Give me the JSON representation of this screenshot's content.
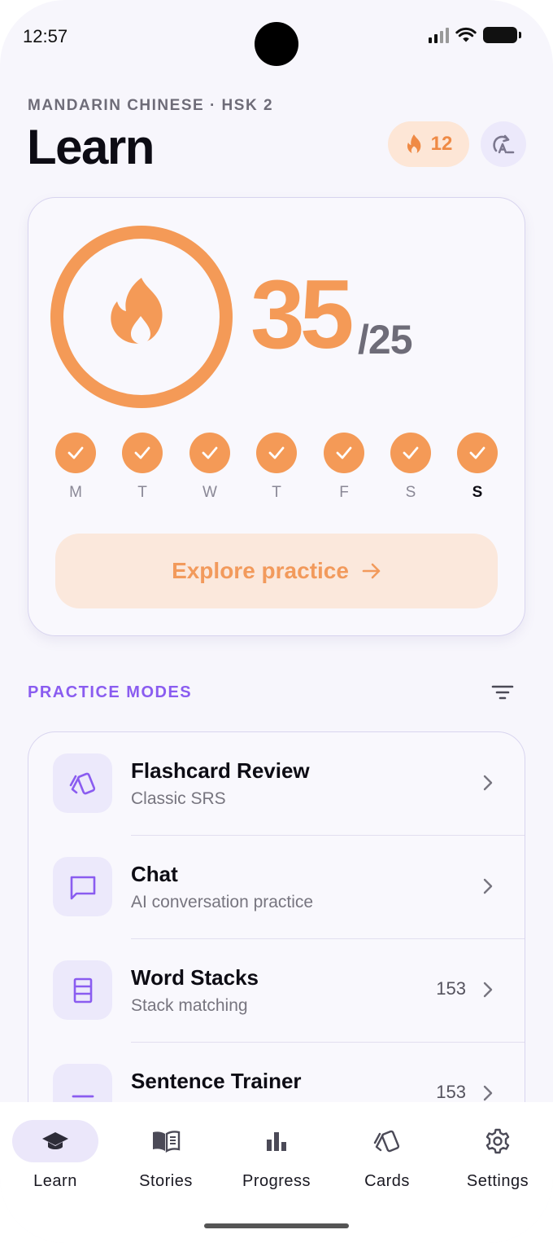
{
  "status_bar": {
    "time": "12:57"
  },
  "header": {
    "subtitle": "MANDARIN CHINESE · HSK 2",
    "title": "Learn",
    "streak_count": "12"
  },
  "progress": {
    "current": "35",
    "goal": "/25",
    "ring_fraction": 1.0
  },
  "week": [
    {
      "letter": "M",
      "done": true,
      "today": false
    },
    {
      "letter": "T",
      "done": true,
      "today": false
    },
    {
      "letter": "W",
      "done": true,
      "today": false
    },
    {
      "letter": "T",
      "done": true,
      "today": false
    },
    {
      "letter": "F",
      "done": true,
      "today": false
    },
    {
      "letter": "S",
      "done": true,
      "today": false
    },
    {
      "letter": "S",
      "done": true,
      "today": true
    }
  ],
  "explore_button": {
    "label": "Explore practice"
  },
  "practice_modes": {
    "label": "PRACTICE MODES",
    "items": [
      {
        "title": "Flashcard Review",
        "subtitle": "Classic SRS",
        "count": "",
        "icon": "cards-icon"
      },
      {
        "title": "Chat",
        "subtitle": "AI conversation practice",
        "count": "",
        "icon": "chat-icon"
      },
      {
        "title": "Word Stacks",
        "subtitle": "Stack matching",
        "count": "153",
        "icon": "stack-icon"
      },
      {
        "title": "Sentence Trainer",
        "subtitle": "",
        "count": "153",
        "icon": "lines-icon"
      }
    ]
  },
  "nav": [
    {
      "label": "Learn",
      "icon": "graduation-cap-icon",
      "active": true
    },
    {
      "label": "Stories",
      "icon": "book-icon",
      "active": false
    },
    {
      "label": "Progress",
      "icon": "bar-chart-icon",
      "active": false
    },
    {
      "label": "Cards",
      "icon": "cards-icon",
      "active": false
    },
    {
      "label": "Settings",
      "icon": "gear-icon",
      "active": false
    }
  ],
  "colors": {
    "accent_orange": "#f49a57",
    "accent_purple": "#8a5cf0",
    "background": "#f7f6fc"
  }
}
